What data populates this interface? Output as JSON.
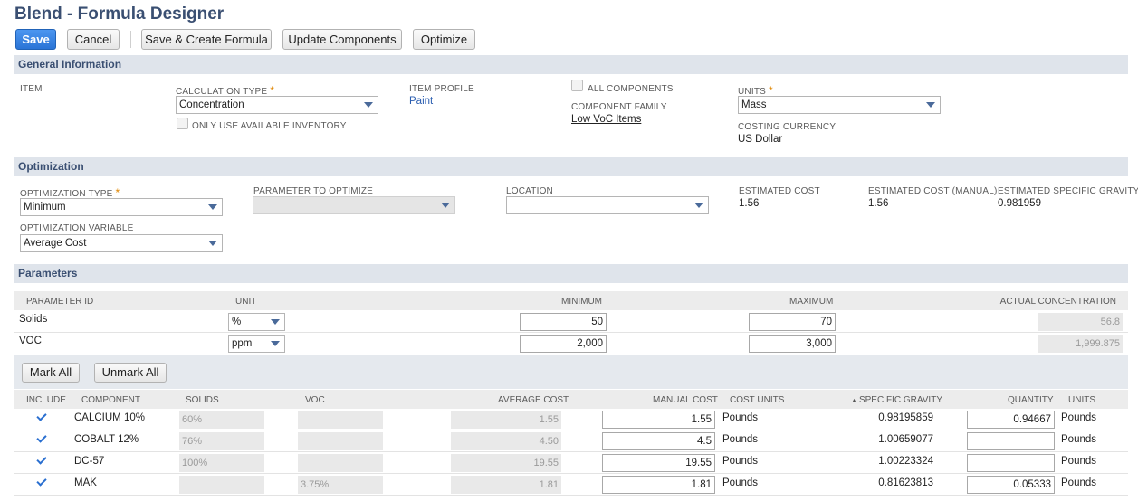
{
  "page": {
    "title": "Blend - Formula Designer"
  },
  "toolbar": {
    "save": "Save",
    "cancel": "Cancel",
    "save_create": "Save & Create Formula",
    "update_components": "Update Components",
    "optimize": "Optimize"
  },
  "general": {
    "header": "General Information",
    "item_label": "ITEM",
    "calc_type_label": "CALCULATION TYPE",
    "calc_type_value": "Concentration",
    "only_available_label": "ONLY USE AVAILABLE INVENTORY",
    "item_profile_label": "ITEM PROFILE",
    "item_profile_value": "Paint",
    "all_components_label": "ALL COMPONENTS",
    "component_family_label": "COMPONENT FAMILY",
    "component_family_value": "Low VoC Items",
    "units_label": "UNITS",
    "units_value": "Mass",
    "costing_currency_label": "COSTING CURRENCY",
    "costing_currency_value": "US Dollar",
    "required_mark": "*"
  },
  "optimization": {
    "header": "Optimization",
    "type_label": "OPTIMIZATION TYPE",
    "type_value": "Minimum",
    "variable_label": "OPTIMIZATION VARIABLE",
    "variable_value": "Average Cost",
    "param_label": "PARAMETER TO OPTIMIZE",
    "location_label": "LOCATION",
    "est_cost_label": "ESTIMATED COST",
    "est_cost_value": "1.56",
    "est_cost_manual_label": "ESTIMATED COST (MANUAL)",
    "est_cost_manual_value": "1.56",
    "est_sg_label": "ESTIMATED SPECIFIC GRAVITY",
    "est_sg_value": "0.981959"
  },
  "parameters": {
    "header": "Parameters",
    "columns": {
      "id": "PARAMETER ID",
      "unit": "UNIT",
      "min": "MINIMUM",
      "max": "MAXIMUM",
      "actual": "ACTUAL CONCENTRATION"
    },
    "rows": [
      {
        "id": "Solids",
        "unit": "%",
        "min": "50",
        "max": "70",
        "actual": "56.8"
      },
      {
        "id": "VOC",
        "unit": "ppm",
        "min": "2,000",
        "max": "3,000",
        "actual": "1,999.875"
      }
    ]
  },
  "components": {
    "mark_all": "Mark All",
    "unmark_all": "Unmark All",
    "columns": {
      "include": "INCLUDE",
      "component": "COMPONENT",
      "solids": "SOLIDS",
      "voc": "VOC",
      "avg_cost": "AVERAGE COST",
      "manual_cost": "MANUAL COST",
      "cost_units": "COST UNITS",
      "sg": "SPECIFIC GRAVITY",
      "sort_glyph": "▲",
      "quantity": "QUANTITY",
      "units": "UNITS"
    },
    "rows": [
      {
        "name": "CALCIUM 10%",
        "solids": "60%",
        "voc": "",
        "avg": "1.55",
        "manual": "1.55",
        "cost_units": "Pounds",
        "sg": "0.98195859",
        "qty": "0.94667",
        "units": "Pounds"
      },
      {
        "name": "COBALT 12%",
        "solids": "76%",
        "voc": "",
        "avg": "4.50",
        "manual": "4.5",
        "cost_units": "Pounds",
        "sg": "1.00659077",
        "qty": "",
        "units": "Pounds"
      },
      {
        "name": "DC-57",
        "solids": "100%",
        "voc": "",
        "avg": "19.55",
        "manual": "19.55",
        "cost_units": "Pounds",
        "sg": "1.00223324",
        "qty": "",
        "units": "Pounds"
      },
      {
        "name": "MAK",
        "solids": "",
        "voc": "3.75%",
        "avg": "1.81",
        "manual": "1.81",
        "cost_units": "Pounds",
        "sg": "0.81623813",
        "qty": "0.05333",
        "units": "Pounds"
      }
    ]
  }
}
